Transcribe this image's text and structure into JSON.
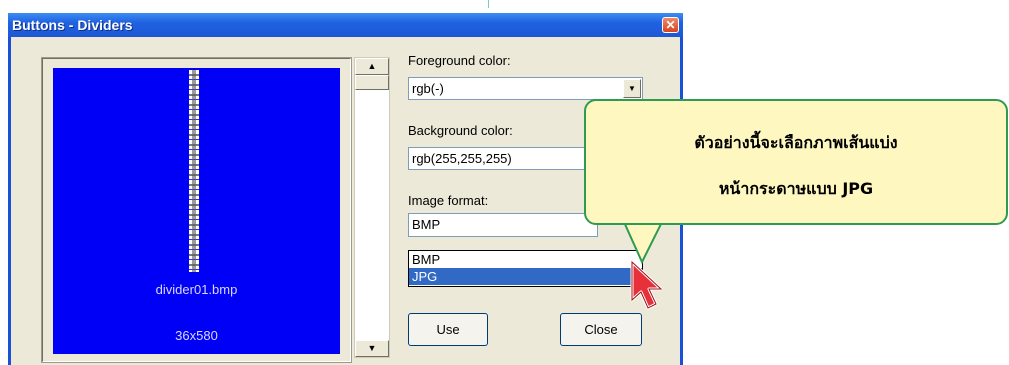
{
  "window": {
    "title": "Buttons - Dividers",
    "close_glyph": "✕"
  },
  "preview": {
    "image_name": "divider01.bmp",
    "image_size": "36x580",
    "background_color": "#0000f6"
  },
  "scrollbar": {
    "up_glyph": "▲",
    "down_glyph": "▼"
  },
  "foreground": {
    "label": "Foreground color:",
    "value": "rgb(-)",
    "arrow_glyph": "▼"
  },
  "background": {
    "label": "Background color:",
    "value": "rgb(255,255,255)"
  },
  "image_format": {
    "label": "Image format:",
    "value": "BMP",
    "options": [
      "BMP",
      "JPG"
    ],
    "selected_option": "JPG"
  },
  "buttons": {
    "use": "Use",
    "close": "Close"
  },
  "callout": {
    "line1": "ตัวอย่างนี้จะเลือกภาพเส้นแบ่ง",
    "line2": "หน้ากระดาษแบบ JPG",
    "fill_color": "#fff7c0",
    "border_color": "#2f9a52"
  },
  "colors": {
    "titlebar": "#1f62e0",
    "dialog_bg": "#ece9d8",
    "selection": "#316ac5"
  },
  "icons": {
    "cursor": "arrow-pointer-icon",
    "close": "close-icon"
  }
}
